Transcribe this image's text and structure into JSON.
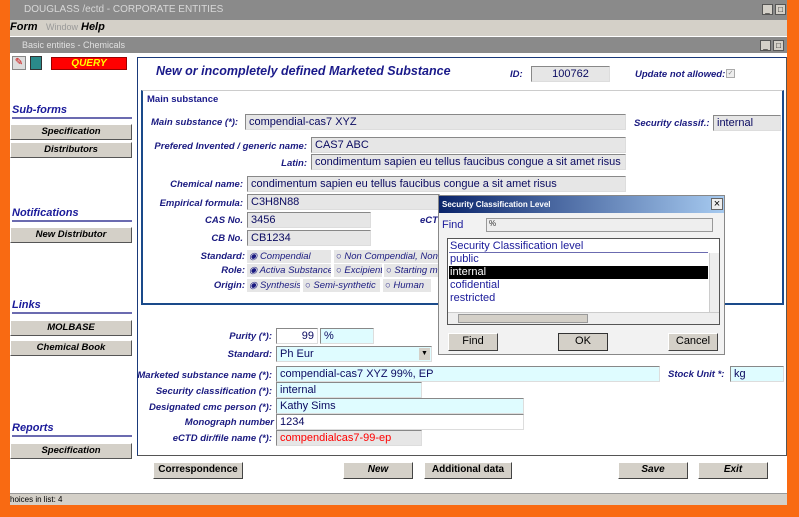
{
  "app": {
    "title": "DOUGLASS /ectd - CORPORATE ENTITIES",
    "menu": [
      "Form",
      "Window",
      "Help"
    ],
    "inner_title": "Basic entities - Chemicals",
    "mode": "QUERY"
  },
  "sidebar": {
    "subforms": {
      "title": "Sub-forms",
      "items": [
        "Specification",
        "Distributors"
      ]
    },
    "notifications": {
      "title": "Notifications",
      "items": [
        "New Distributor"
      ]
    },
    "links": {
      "title": "Links",
      "items": [
        "MOLBASE",
        "Chemical Book"
      ]
    },
    "reports": {
      "title": "Reports",
      "items": [
        "Specification"
      ]
    }
  },
  "form": {
    "title": "New or incompletely defined Marketed Substance",
    "id_label": "ID:",
    "id": "100762",
    "update_label": "Update not allowed:",
    "group": "Main substance",
    "main_substance_label": "Main substance  (*):",
    "main_substance": "compendial-cas7 XYZ",
    "security_label": "Security classif.:",
    "security": "internal",
    "pref_label": "Prefered Invented / generic name:",
    "pref": "CAS7 ABC",
    "latin_label": "Latin:",
    "latin": "condimentum sapien eu tellus faucibus congue a sit amet risus",
    "chem_label": "Chemical name:",
    "chem": "condimentum sapien eu tellus faucibus congue a sit amet risus",
    "emp_label": "Empirical formula:",
    "emp": "C3H8N88",
    "cas_label": "CAS No.",
    "cas": "3456",
    "ectd_partial": "eCT",
    "cb_label": "CB No.",
    "cb": "CB1234",
    "standard_label": "Standard:",
    "standard_opts": [
      "Compendial",
      "Non Compendial, Non M"
    ],
    "role_label": "Role:",
    "role_opts": [
      "Activa Substance",
      "Excipient",
      "Starting m."
    ],
    "origin_label": "Origin:",
    "origin_opts": [
      "Synthesis",
      "Semi-synthetic",
      "Human"
    ],
    "purity_label": "Purity (*):",
    "purity": "99",
    "purity_unit": "%",
    "std2_label": "Standard:",
    "std2": "Ph Eur",
    "msn_label": "Marketed substance name (*):",
    "msn": "compendial-cas7 XYZ 99%, EP",
    "stock_label": "Stock Unit *:",
    "stock": "kg",
    "sc_label": "Security classification (*):",
    "sc": "internal",
    "person_label": "Designated cmc person (*):",
    "person": "Kathy Sims",
    "mono_label": "Monograph number",
    "mono": "1234",
    "ectd_label": "eCTD dir/file name (*):",
    "ectd": "compendialcas7-99-ep"
  },
  "buttons": {
    "correspondence": "Correspondence",
    "new": "New",
    "additional": "Additional data",
    "save": "Save",
    "exit": "Exit"
  },
  "status": "hoices in list: 4",
  "dialog": {
    "title": "Security Classification Level",
    "find_label": "Find",
    "find_value": "%",
    "header": "Security Classification level",
    "items": [
      "public",
      "internal",
      "cofidential",
      "restricted"
    ],
    "selected": 1,
    "find_btn": "Find",
    "ok": "OK",
    "cancel": "Cancel",
    "close": "×"
  }
}
